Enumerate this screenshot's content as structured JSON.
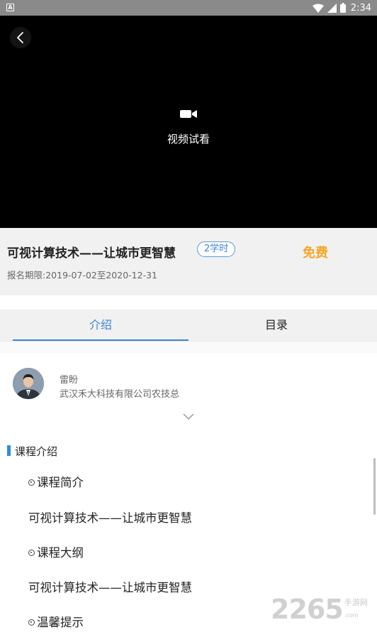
{
  "status_bar": {
    "notification_glyph": "A",
    "time": "2:34"
  },
  "video": {
    "trial_label": "视频试看"
  },
  "course": {
    "title": "可视计算技术——让城市更智慧",
    "hours_badge": "2学时",
    "price": "免费",
    "enroll_period": "报名期限:2019-07-02至2020-12-31"
  },
  "tabs": {
    "intro": "介绍",
    "catalog": "目录"
  },
  "teacher": {
    "name": "雷盼",
    "organization": "武汉禾大科技有限公司农技总"
  },
  "content": {
    "section_title": "课程介绍",
    "items": [
      {
        "type": "bullet",
        "text": "课程简介"
      },
      {
        "type": "text",
        "text": "可视计算技术——让城市更智慧"
      },
      {
        "type": "bullet",
        "text": "课程大纲"
      },
      {
        "type": "text",
        "text": "可视计算技术——让城市更智慧"
      },
      {
        "type": "bullet",
        "text": "温馨提示"
      }
    ]
  },
  "watermark": {
    "number": "2265",
    "sub_text": "手游网",
    "domain": ".com"
  },
  "colors": {
    "accent": "#3a86d1",
    "price": "#f5a623",
    "section_bar": "#2a8ee0"
  }
}
